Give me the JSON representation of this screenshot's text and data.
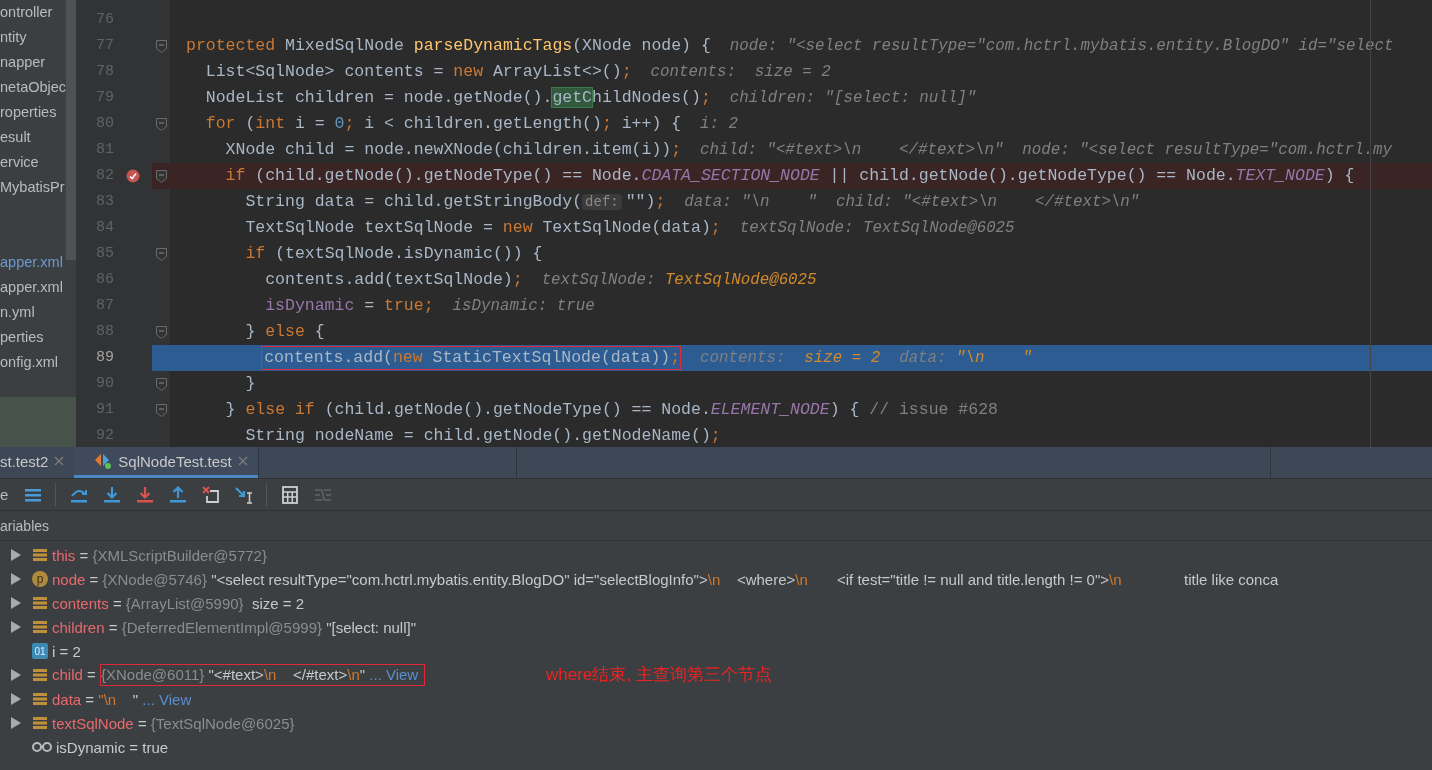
{
  "project_tree": {
    "folders": [
      {
        "label": "ontroller",
        "modified": false
      },
      {
        "label": "ntity",
        "modified": false
      },
      {
        "label": "napper",
        "modified": false
      },
      {
        "label": "netaObjec",
        "modified": false
      },
      {
        "label": "roperties",
        "modified": false
      },
      {
        "label": "esult",
        "modified": false
      },
      {
        "label": "ervice",
        "modified": false
      },
      {
        "label": "MybatisPr",
        "modified": false
      }
    ],
    "files": [
      {
        "label": "apper.xml",
        "modified": true
      },
      {
        "label": "apper.xml",
        "modified": false
      },
      {
        "label": "n.yml",
        "modified": false
      },
      {
        "label": "perties",
        "modified": false
      },
      {
        "label": "onfig.xml",
        "modified": false
      }
    ]
  },
  "editor": {
    "lines": [
      {
        "number": "76",
        "fold": false,
        "breakpoint": false,
        "current": false
      },
      {
        "number": "77",
        "fold": true,
        "breakpoint": false,
        "current": false,
        "segments": [
          {
            "kind": "kw",
            "text": "protected "
          },
          {
            "kind": "plain",
            "text": "MixedSqlNode "
          },
          {
            "kind": "decl",
            "text": "parseDynamicTags"
          },
          {
            "kind": "plain",
            "text": "(XNode node) {"
          },
          {
            "kind": "hint",
            "text": "  node: \"<select resultType=\"com.hctrl.mybatis.entity.BlogDO\" id=\"select"
          }
        ]
      },
      {
        "number": "78",
        "fold": false,
        "breakpoint": false,
        "current": false,
        "segments": [
          {
            "kind": "plain",
            "text": "  List<SqlNode> contents = "
          },
          {
            "kind": "kw",
            "text": "new "
          },
          {
            "kind": "plain",
            "text": "ArrayList<>()"
          },
          {
            "kind": "kw",
            "text": ";"
          },
          {
            "kind": "hint",
            "text": "  contents:  size = 2"
          }
        ]
      },
      {
        "number": "79",
        "fold": false,
        "breakpoint": false,
        "current": false,
        "segments": [
          {
            "kind": "plain",
            "text": "  NodeList children = node.getNode()."
          },
          {
            "kind": "match",
            "text": "getC"
          },
          {
            "kind": "plain",
            "text": "hildNodes()"
          },
          {
            "kind": "kw",
            "text": ";"
          },
          {
            "kind": "hint",
            "text": "  children: \"[select: null]\""
          }
        ]
      },
      {
        "number": "80",
        "fold": true,
        "breakpoint": false,
        "current": false,
        "segments": [
          {
            "kind": "kw",
            "text": "  for "
          },
          {
            "kind": "plain",
            "text": "("
          },
          {
            "kind": "kw",
            "text": "int "
          },
          {
            "kind": "plain",
            "text": "i = "
          },
          {
            "kind": "num",
            "text": "0"
          },
          {
            "kind": "kw",
            "text": "; "
          },
          {
            "kind": "plain",
            "text": "i < children.getLength()"
          },
          {
            "kind": "kw",
            "text": "; "
          },
          {
            "kind": "plain",
            "text": "i++) {"
          },
          {
            "kind": "hint",
            "text": "  i: 2"
          }
        ]
      },
      {
        "number": "81",
        "fold": false,
        "breakpoint": false,
        "current": false,
        "segments": [
          {
            "kind": "plain",
            "text": "    XNode child = node.newXNode(children.item(i))"
          },
          {
            "kind": "kw",
            "text": ";"
          },
          {
            "kind": "hint",
            "text": "  child: \"<#text>\\n    </#text>\\n\"  node: \"<select resultType=\"com.hctrl.my"
          }
        ]
      },
      {
        "number": "82",
        "fold": true,
        "breakpoint": true,
        "current": false,
        "segments": [
          {
            "kind": "kw",
            "text": "    if "
          },
          {
            "kind": "plain",
            "text": "(child.getNode().getNodeType() == Node."
          },
          {
            "kind": "const",
            "text": "CDATA_SECTION_NODE"
          },
          {
            "kind": "plain",
            "text": " || child.getNode().getNodeType() == Node."
          },
          {
            "kind": "const",
            "text": "TEXT_NODE"
          },
          {
            "kind": "plain",
            "text": ") {"
          }
        ]
      },
      {
        "number": "83",
        "fold": false,
        "breakpoint": false,
        "current": false,
        "segments": [
          {
            "kind": "plain",
            "text": "      String data = child.getStringBody("
          },
          {
            "kind": "param",
            "text": "def:"
          },
          {
            "kind": "plain",
            "text": "\"\")"
          },
          {
            "kind": "kw",
            "text": ";"
          },
          {
            "kind": "hint",
            "text": "  data: \"\\n    \"  child: \"<#text>\\n    </#text>\\n\""
          }
        ]
      },
      {
        "number": "84",
        "fold": false,
        "breakpoint": false,
        "current": false,
        "segments": [
          {
            "kind": "plain",
            "text": "      TextSqlNode textSqlNode = "
          },
          {
            "kind": "kw",
            "text": "new "
          },
          {
            "kind": "plain",
            "text": "TextSqlNode(data)"
          },
          {
            "kind": "kw",
            "text": ";"
          },
          {
            "kind": "hint",
            "text": "  textSqlNode: TextSqlNode@6025"
          }
        ]
      },
      {
        "number": "85",
        "fold": true,
        "breakpoint": false,
        "current": false,
        "segments": [
          {
            "kind": "kw",
            "text": "      if "
          },
          {
            "kind": "plain",
            "text": "(textSqlNode.isDynamic()) {"
          }
        ]
      },
      {
        "number": "86",
        "fold": false,
        "breakpoint": false,
        "current": false,
        "segments": [
          {
            "kind": "plain",
            "text": "        contents.add(textSqlNode)"
          },
          {
            "kind": "kw",
            "text": ";"
          },
          {
            "kind": "hint",
            "text": "  textSqlNode: "
          },
          {
            "kind": "changed",
            "text": "TextSqlNode@6025"
          }
        ]
      },
      {
        "number": "87",
        "fold": false,
        "breakpoint": false,
        "current": false,
        "segments": [
          {
            "kind": "field",
            "text": "        isDynamic"
          },
          {
            "kind": "plain",
            "text": " = "
          },
          {
            "kind": "kw",
            "text": "true;"
          },
          {
            "kind": "hint",
            "text": "  isDynamic: true"
          }
        ]
      },
      {
        "number": "88",
        "fold": true,
        "breakpoint": false,
        "current": false,
        "segments": [
          {
            "kind": "plain",
            "text": "      } "
          },
          {
            "kind": "kw",
            "text": "else "
          },
          {
            "kind": "plain",
            "text": "{"
          }
        ]
      },
      {
        "number": "89",
        "fold": false,
        "breakpoint": false,
        "current": true,
        "boxed": true,
        "segments": [
          {
            "kind": "plain",
            "text": "        contents.add("
          },
          {
            "kind": "kw",
            "text": "new "
          },
          {
            "kind": "plain",
            "text": "StaticTextSqlNode(data))"
          },
          {
            "kind": "kw",
            "text": ";"
          },
          {
            "kind": "hint",
            "text": "  contents:  "
          },
          {
            "kind": "changed",
            "text": "size = 2"
          },
          {
            "kind": "hint",
            "text": "  data: "
          },
          {
            "kind": "changed",
            "text": "\"\\n    \""
          }
        ]
      },
      {
        "number": "90",
        "fold": true,
        "breakpoint": false,
        "current": false,
        "segments": [
          {
            "kind": "plain",
            "text": "      }"
          }
        ]
      },
      {
        "number": "91",
        "fold": true,
        "breakpoint": false,
        "current": false,
        "segments": [
          {
            "kind": "plain",
            "text": "    } "
          },
          {
            "kind": "kw",
            "text": "else if "
          },
          {
            "kind": "plain",
            "text": "(child.getNode().getNodeType() == Node."
          },
          {
            "kind": "const",
            "text": "ELEMENT_NODE"
          },
          {
            "kind": "plain",
            "text": ") { "
          },
          {
            "kind": "comment",
            "text": "// issue #628"
          }
        ]
      },
      {
        "number": "92",
        "fold": false,
        "breakpoint": false,
        "current": false,
        "segments": [
          {
            "kind": "plain",
            "text": "      String nodeName = child.getNode().getNodeName()"
          },
          {
            "kind": "kw",
            "text": ";"
          }
        ]
      }
    ]
  },
  "debug_tabs": [
    {
      "label": "st.test2",
      "selected": false,
      "icon": false
    },
    {
      "label": "SqlNodeTest.test",
      "selected": true,
      "icon": true
    }
  ],
  "toolbar": {
    "cut_label": "e",
    "tools": [
      {
        "kind": "frames",
        "disabled": false
      },
      {
        "kind": "step-over",
        "disabled": false
      },
      {
        "kind": "step-into",
        "disabled": false
      },
      {
        "kind": "force-step-into",
        "disabled": false
      },
      {
        "kind": "step-out",
        "disabled": false
      },
      {
        "kind": "drop-frame",
        "disabled": false
      },
      {
        "kind": "run-to-cursor",
        "disabled": false
      },
      {
        "kind": "evaluate",
        "disabled": false,
        "separator_before": true
      },
      {
        "kind": "trace",
        "disabled": true
      }
    ]
  },
  "variables": {
    "title": "ariables",
    "rows": [
      {
        "expandable": true,
        "kind": "field",
        "name": "this",
        "value": [
          {
            "kind": "plain",
            "text": " = "
          },
          {
            "kind": "ref",
            "text": "{XMLScriptBuilder@5772}"
          }
        ]
      },
      {
        "expandable": true,
        "kind": "param",
        "badge": "p",
        "name": "node",
        "value": [
          {
            "kind": "plain",
            "text": " = "
          },
          {
            "kind": "ref",
            "text": "{XNode@5746}"
          },
          {
            "kind": "plain",
            "text": " \"<select resultType=\"com.hctrl.mybatis.entity.BlogDO\" id=\"selectBlogInfo\">"
          },
          {
            "kind": "esc",
            "text": "\\n"
          },
          {
            "kind": "plain",
            "text": "    <where>"
          },
          {
            "kind": "esc",
            "text": "\\n"
          },
          {
            "kind": "plain",
            "text": "       <if test=\"title != null and title.length != 0\">"
          },
          {
            "kind": "esc",
            "text": "\\n"
          },
          {
            "kind": "plain",
            "text": "               title like conca"
          }
        ]
      },
      {
        "expandable": true,
        "kind": "field",
        "name": "contents",
        "value": [
          {
            "kind": "plain",
            "text": " = "
          },
          {
            "kind": "ref",
            "text": "{ArrayList@5990}"
          },
          {
            "kind": "plain",
            "text": "  size = 2"
          }
        ]
      },
      {
        "expandable": true,
        "kind": "field",
        "name": "children",
        "value": [
          {
            "kind": "plain",
            "text": " = "
          },
          {
            "kind": "ref",
            "text": "{DeferredElementImpl@5999}"
          },
          {
            "kind": "plain",
            "text": " \"[select: null]\""
          }
        ]
      },
      {
        "expandable": false,
        "kind": "primitive",
        "badge": "01",
        "name": "i",
        "value": [
          {
            "kind": "plain",
            "text": " = 2"
          }
        ]
      },
      {
        "expandable": true,
        "kind": "field",
        "name": "child",
        "boxed": true,
        "value": [
          {
            "kind": "plain",
            "text": " = "
          },
          {
            "kind": "ref",
            "text": "{XNode@6011}"
          },
          {
            "kind": "plain",
            "text": " \"<#text>"
          },
          {
            "kind": "esc",
            "text": "\\n"
          },
          {
            "kind": "plain",
            "text": "    </#text>"
          },
          {
            "kind": "esc",
            "text": "\\n"
          },
          {
            "kind": "plain",
            "text": "\""
          },
          {
            "kind": "link",
            "text": " ... View"
          }
        ]
      },
      {
        "expandable": true,
        "kind": "field",
        "name": "data",
        "value": [
          {
            "kind": "plain",
            "text": " = "
          },
          {
            "kind": "esc",
            "text": "\"\\n"
          },
          {
            "kind": "plain",
            "text": "    \""
          },
          {
            "kind": "link",
            "text": " ... View"
          }
        ]
      },
      {
        "expandable": true,
        "kind": "field",
        "name": "textSqlNode",
        "value": [
          {
            "kind": "plain",
            "text": " = "
          },
          {
            "kind": "ref",
            "text": "{TextSqlNode@6025}"
          }
        ]
      },
      {
        "expandable": false,
        "kind": "watch",
        "name": "isDynamic",
        "value": [
          {
            "kind": "plain",
            "text": " = true"
          }
        ]
      }
    ],
    "note": "where结束, 主查询第三个节点"
  }
}
